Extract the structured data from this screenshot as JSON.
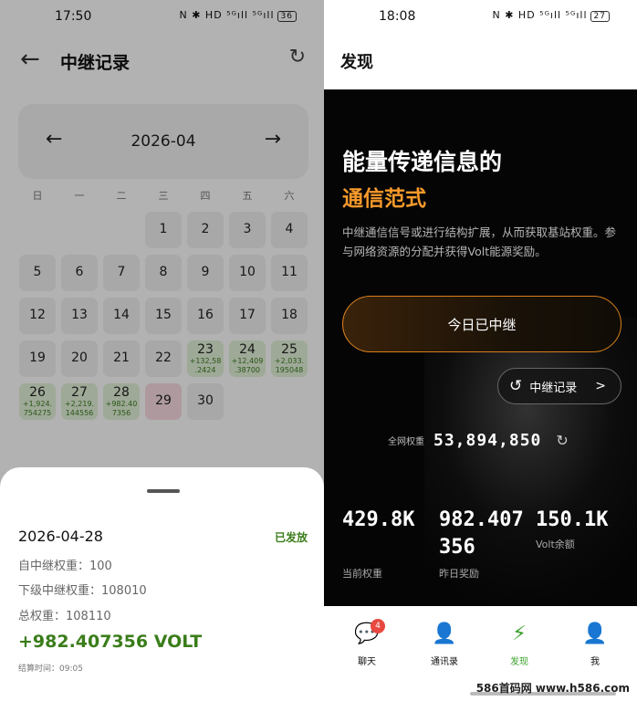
{
  "left": {
    "status": {
      "time": "17:50",
      "icons": "N ✱ HD ⁵ᴳıll ⁵ᴳıll",
      "battery": "36"
    },
    "header": {
      "title": "中继记录"
    },
    "month": {
      "label": "2026-04"
    },
    "weekdays": [
      "日",
      "一",
      "二",
      "三",
      "四",
      "五",
      "六"
    ],
    "days": [
      {
        "d": "",
        "e1": "",
        "e2": "",
        "s": "empty"
      },
      {
        "d": "",
        "e1": "",
        "e2": "",
        "s": "empty"
      },
      {
        "d": "",
        "e1": "",
        "e2": "",
        "s": "empty"
      },
      {
        "d": "1",
        "e1": "",
        "e2": "",
        "s": ""
      },
      {
        "d": "2",
        "e1": "",
        "e2": "",
        "s": ""
      },
      {
        "d": "3",
        "e1": "",
        "e2": "",
        "s": ""
      },
      {
        "d": "4",
        "e1": "",
        "e2": "",
        "s": ""
      },
      {
        "d": "5",
        "e1": "",
        "e2": "",
        "s": ""
      },
      {
        "d": "6",
        "e1": "",
        "e2": "",
        "s": ""
      },
      {
        "d": "7",
        "e1": "",
        "e2": "",
        "s": ""
      },
      {
        "d": "8",
        "e1": "",
        "e2": "",
        "s": ""
      },
      {
        "d": "9",
        "e1": "",
        "e2": "",
        "s": ""
      },
      {
        "d": "10",
        "e1": "",
        "e2": "",
        "s": ""
      },
      {
        "d": "11",
        "e1": "",
        "e2": "",
        "s": ""
      },
      {
        "d": "12",
        "e1": "",
        "e2": "",
        "s": ""
      },
      {
        "d": "13",
        "e1": "",
        "e2": "",
        "s": ""
      },
      {
        "d": "14",
        "e1": "",
        "e2": "",
        "s": ""
      },
      {
        "d": "15",
        "e1": "",
        "e2": "",
        "s": ""
      },
      {
        "d": "16",
        "e1": "",
        "e2": "",
        "s": ""
      },
      {
        "d": "17",
        "e1": "",
        "e2": "",
        "s": ""
      },
      {
        "d": "18",
        "e1": "",
        "e2": "",
        "s": ""
      },
      {
        "d": "19",
        "e1": "",
        "e2": "",
        "s": ""
      },
      {
        "d": "20",
        "e1": "",
        "e2": "",
        "s": ""
      },
      {
        "d": "21",
        "e1": "",
        "e2": "",
        "s": ""
      },
      {
        "d": "22",
        "e1": "",
        "e2": "",
        "s": ""
      },
      {
        "d": "23",
        "e1": "+132,58",
        "e2": ".2424",
        "s": "g"
      },
      {
        "d": "24",
        "e1": "+12,409",
        "e2": ".38700",
        "s": "g"
      },
      {
        "d": "25",
        "e1": "+2,033.",
        "e2": "195048",
        "s": "g"
      },
      {
        "d": "26",
        "e1": "+1,924.",
        "e2": "754275",
        "s": "g"
      },
      {
        "d": "27",
        "e1": "+2,219.",
        "e2": "144556",
        "s": "g"
      },
      {
        "d": "28",
        "e1": "+982.40",
        "e2": "7356",
        "s": "g"
      },
      {
        "d": "29",
        "e1": "",
        "e2": "",
        "s": "p"
      },
      {
        "d": "30",
        "e1": "",
        "e2": "",
        "s": ""
      }
    ],
    "sheet": {
      "date": "2026-04-28",
      "status": "已发放",
      "self_weight": "自中继权重：100",
      "sub_weight": "下级中继权重：108010",
      "total_weight": "总权重：108110",
      "amount": "+982.407356 VOLT",
      "settle_time": "结算时间：09:05"
    }
  },
  "right": {
    "status": {
      "time": "18:08",
      "icons": "N ✱ HD ⁵ᴳıll ⁵ᴳıll",
      "battery": "27"
    },
    "header": {
      "title": "发现"
    },
    "hero": {
      "line1": "能量传递信息的",
      "line2": "通信范式",
      "desc": "中继通信信号或进行结构扩展，从而获取基站权重。参与网络资源的分配并获得Volt能源奖励。"
    },
    "relay_button": "今日已中继",
    "record_button": "中继记录",
    "network": {
      "label": "全网权重",
      "value": "53,894,850"
    },
    "stats": {
      "current_weight": "429.8K",
      "current_weight_label": "当前权重",
      "yesterday_reward": "982.407356",
      "yesterday_reward_label": "昨日奖励",
      "balance": "150.1K",
      "balance_label": "Volt余额"
    },
    "tabs": [
      {
        "label": "聊天",
        "badge": "4"
      },
      {
        "label": "通讯录"
      },
      {
        "label": "发现"
      },
      {
        "label": "我"
      }
    ],
    "watermark": "586首码网 www.h586.com"
  },
  "colors": {
    "accent_green": "#3a7d1a",
    "accent_orange": "#f79a2b",
    "badge_red": "#e8483f"
  }
}
